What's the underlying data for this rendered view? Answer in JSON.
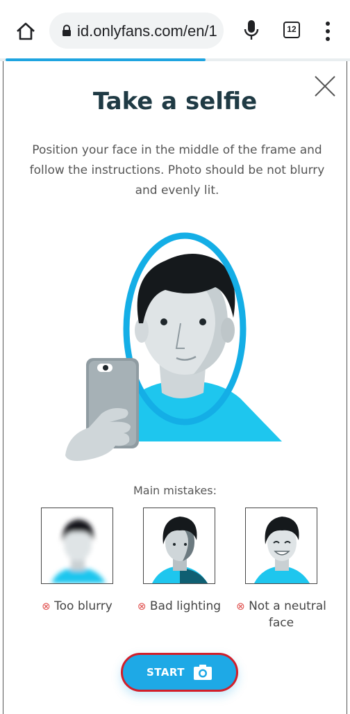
{
  "browser": {
    "url": "id.onlyfans.com/en/1",
    "tab_count": "12"
  },
  "progress_percent": 58,
  "content": {
    "title": "Take a selfie",
    "description": "Position your face in the middle of the frame and follow the instructions. Photo should be not blurry and evenly lit.",
    "mistakes_label": "Main mistakes:",
    "mistakes": [
      {
        "label": "Too blurry"
      },
      {
        "label": "Bad lighting"
      },
      {
        "label": "Not a neutral face"
      }
    ],
    "start_label": "START"
  },
  "icons": {
    "home": "home-icon",
    "lock": "lock-icon",
    "mic": "mic-icon",
    "tabs": "tab-switcher-icon",
    "menu": "more-vert-icon",
    "close": "close-icon",
    "camera": "camera-icon",
    "error": "circle-x-icon"
  },
  "colors": {
    "accent": "#1ea9e6",
    "title": "#1f3a44",
    "error": "#e0514f",
    "highlight_border": "#d21f2a"
  }
}
